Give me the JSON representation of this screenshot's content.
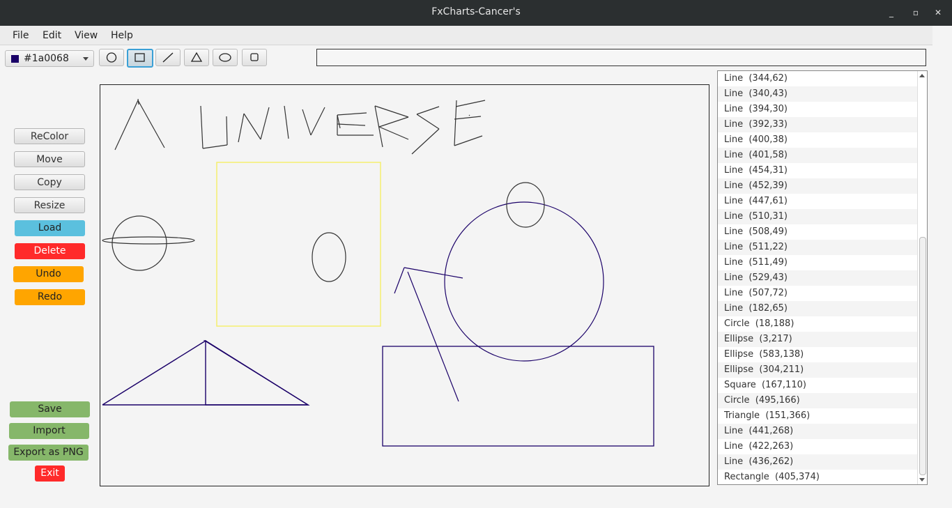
{
  "window": {
    "title": "FxCharts-Cancer's",
    "controls": [
      "_",
      "▫",
      "✕"
    ]
  },
  "menu": [
    "File",
    "Edit",
    "View",
    "Help"
  ],
  "toolbar": {
    "color_value": "#1a0068",
    "tools": [
      "circle-tool",
      "rectangle-tool",
      "line-tool",
      "triangle-tool",
      "ellipse-tool",
      "square-tool"
    ],
    "status_text": ""
  },
  "side_buttons": {
    "recolor": "ReColor",
    "move": "Move",
    "copy": "Copy",
    "resize": "Resize",
    "load": "Load",
    "delete": "Delete",
    "undo": "Undo",
    "redo": "Redo",
    "save": "Save",
    "import": "Import",
    "export": "Export as PNG",
    "exit": "Exit"
  },
  "shape_list": [
    "Line  (344,62)",
    "Line  (340,43)",
    "Line  (394,30)",
    "Line  (392,33)",
    "Line  (400,38)",
    "Line  (401,58)",
    "Line  (454,31)",
    "Line  (452,39)",
    "Line  (447,61)",
    "Line  (510,31)",
    "Line  (508,49)",
    "Line  (511,22)",
    "Line  (511,49)",
    "Line  (529,43)",
    "Line  (507,72)",
    "Line  (182,65)",
    "Circle  (18,188)",
    "Ellipse  (3,217)",
    "Ellipse  (583,138)",
    "Ellipse  (304,211)",
    "Square  (167,110)",
    "Circle  (495,166)",
    "Triangle  (151,366)",
    "Line  (441,268)",
    "Line  (422,263)",
    "Line  (436,262)",
    "Rectangle  (405,374)"
  ],
  "colors": {
    "dark_stroke": "#1a0068",
    "yellow_stroke": "#f5ef6e",
    "black_stroke": "#333333"
  }
}
